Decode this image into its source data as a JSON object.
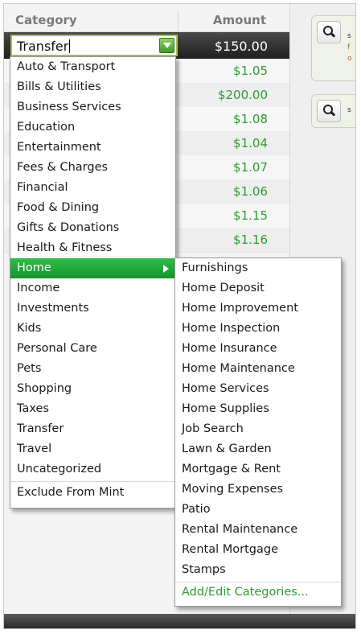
{
  "table": {
    "headers": {
      "category": "Category",
      "amount": "Amount"
    },
    "selected_row": {
      "category_value": "Transfer",
      "amount": "$150.00"
    },
    "amounts": [
      "$1.05",
      "$200.00",
      "$1.08",
      "$1.04",
      "$1.07",
      "$1.06",
      "$1.15",
      "$1.16"
    ]
  },
  "category_menu": {
    "items": [
      "Auto & Transport",
      "Bills & Utilities",
      "Business Services",
      "Education",
      "Entertainment",
      "Fees & Charges",
      "Financial",
      "Food & Dining",
      "Gifts & Donations",
      "Health & Fitness",
      "Home",
      "Income",
      "Investments",
      "Kids",
      "Personal Care",
      "Pets",
      "Shopping",
      "Taxes",
      "Transfer",
      "Travel",
      "Uncategorized"
    ],
    "active_item": "Home",
    "exclude_label": "Exclude From Mint"
  },
  "subcategory_menu": {
    "items": [
      "Furnishings",
      "Home Deposit",
      "Home Improvement",
      "Home Inspection",
      "Home Insurance",
      "Home Maintenance",
      "Home Services",
      "Home Supplies",
      "Job Search",
      "Lawn & Garden",
      "Mortgage & Rent",
      "Moving Expenses",
      "Patio",
      "Rental Maintenance",
      "Rental Mortgage",
      "Stamps"
    ],
    "add_edit_label": "Add/Edit Categories..."
  },
  "side_panel": {
    "card1_snippets": [
      "s",
      "f",
      "o"
    ],
    "card2_snippets": [
      "s"
    ],
    "icon": "search-icon"
  },
  "colors": {
    "accent_green": "#13962c",
    "amount_green": "#2e9b30",
    "selected_row_bg": "#2a2a2a"
  }
}
